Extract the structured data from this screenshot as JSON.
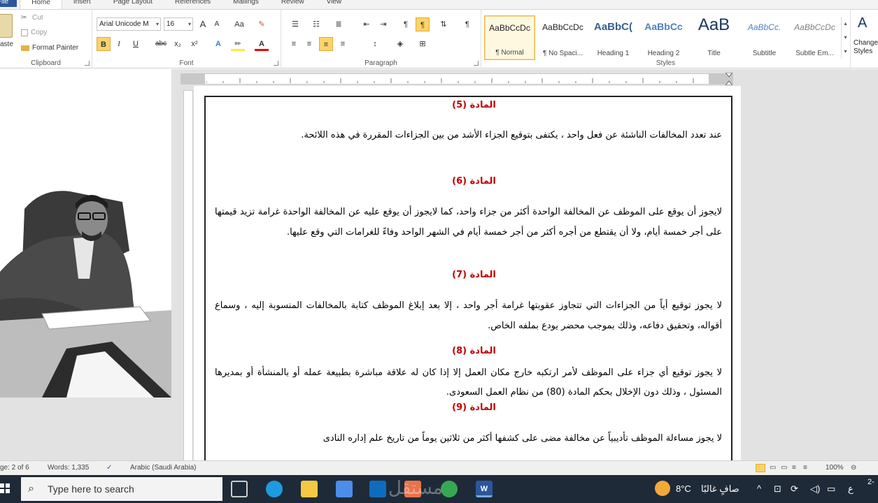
{
  "ribbon": {
    "tabs": [
      "File",
      "Home",
      "Insert",
      "Page Layout",
      "References",
      "Mailings",
      "Review",
      "View"
    ],
    "clipboard": {
      "paste": "aste",
      "cut": "Cut",
      "copy": "Copy",
      "format_painter": "Format Painter",
      "label": "Clipboard"
    },
    "font": {
      "name": "Arial Unicode M",
      "size": "16",
      "label": "Font",
      "bold": "B",
      "italic": "I",
      "underline": "U",
      "strike": "abc",
      "sub": "x₂",
      "sup": "x²",
      "grow": "A",
      "shrink": "A",
      "case": "Aa"
    },
    "paragraph": {
      "label": "Paragraph",
      "show_marks": "¶"
    },
    "styles": {
      "label": "Styles",
      "items": [
        {
          "sample": "AaBbCcDc",
          "name": "¶ Normal"
        },
        {
          "sample": "AaBbCcDc",
          "name": "¶ No Spaci..."
        },
        {
          "sample": "AaBbC(",
          "name": "Heading 1"
        },
        {
          "sample": "AaBbCc",
          "name": "Heading 2"
        },
        {
          "sample": "AaB",
          "name": "Title"
        },
        {
          "sample": "AaBbCc.",
          "name": "Subtitle"
        },
        {
          "sample": "AaBbCcDc",
          "name": "Subtle Em..."
        }
      ],
      "change": "Change Styles"
    }
  },
  "document": {
    "sections": [
      {
        "heading": "المادة (5)",
        "text": "عند تعدد المخالفات الناشئة عن فعل واحد ، يكتفى بتوقيع الجزاء الأشد من بين الجزاءات المقررة في هذه اللائحة."
      },
      {
        "heading": "المادة (6)",
        "text": "لايجوز أن يوقع على الموظف عن المخالفة الواحدة أكثر من جزاء واحد، كما لايجوز أن يوقع عليه عن المخالفة الواحدة غرامة تزيد قيمتها على أجر خمسة أيام، ولا أن يقتطع من أجره أكثر من أجر خمسة أيام في الشهر الواحد وفاءً للغرامات التي وقع عليها."
      },
      {
        "heading": "المادة (7)",
        "text": "لا يجوز توقيع أياً من الجزاءات التي تتجاوز عقوبتها غرامة أجر واحد ، إلا بعد إبلاغ الموظف كتابة بالمخالفات المنسوبة إليه ، وسماع أقواله، وتحقيق دفاعه، وذلك بموجب محضر يودع بملفه الخاص."
      },
      {
        "heading": "المادة (8)",
        "text": "لا يجوز توقيع أي جزاء على الموظف لأمر ارتكبه خارج مكان العمل إلا إذا كان له علاقة مباشرة بطبيعة عمله أو بالمنشأة أو بمديرها المسئول ، وذلك دون الإخلال بحكم المادة (80) من نظام العمل السعودى."
      },
      {
        "heading": "المادة (9)",
        "text": "لا يجوز مساءلة الموظف تأديبياً عن مخالفة مضى على كشفها أكثر من ثلاثين يوماً من تاريخ علم إداره النادى"
      }
    ]
  },
  "status": {
    "page": "ge: 2 of 6",
    "words": "Words: 1,335",
    "language": "Arabic (Saudi Arabia)",
    "zoom": "100%"
  },
  "taskbar": {
    "search_placeholder": "Type here to search",
    "weather_temp": "8°C",
    "weather_text": "صافٍ غالبًا",
    "lang": "ع",
    "clock": "2-",
    "watermark": "مستقل"
  }
}
